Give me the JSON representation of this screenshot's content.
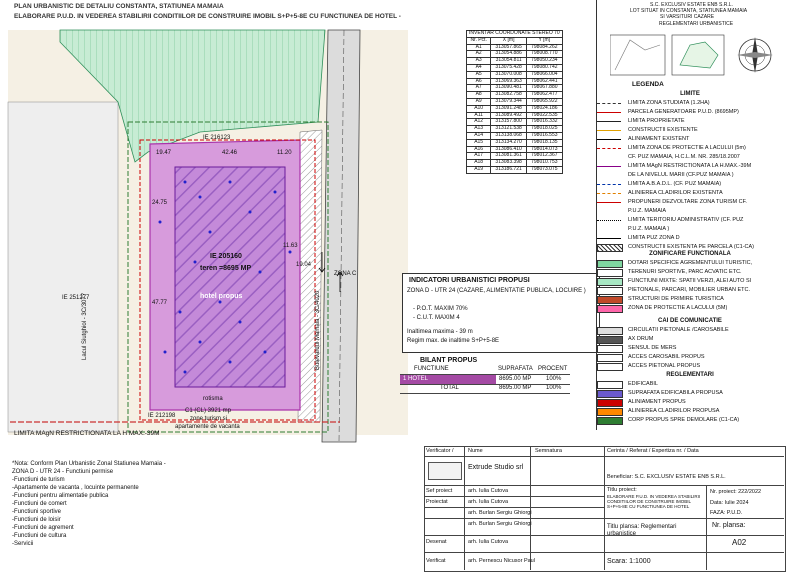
{
  "header": {
    "line1": "PLAN URBANISTIC  DE DETALIU CONSTANTA, STATIUNEA MAMAIA",
    "line2": "ELABORARE  P.U.D. IN VEDEREA STABILIRII CONDITIILOR DE CONSTRUIRE IMOBIL S+P+5-8E CU FUNCTIUNEA DE HOTEL  -"
  },
  "plan": {
    "ie_top": "IE 216123",
    "ie_main": "IE 205160",
    "teren": "teren  =8695 MP",
    "hotel": "hotel propus",
    "ie_left": "IE 251277",
    "ie_bottom": "IE 212198",
    "c1": "C1 (CL) 3921 mp",
    "zone_line1": "zone turism si",
    "zone_line2": "apartamente de vacanta",
    "rotisma": "rotisma",
    "street_left": "Lacul Siutghiol - 3C/3077",
    "street_right": "Bulevardul Mamaia - 3C/4020",
    "limita_label": "LIMITA MAgN RESTRICTIONATA LA H MAX.-39M",
    "zona_c": "ZONA C",
    "dims": [
      "19.47",
      "42.46",
      "11.20",
      "19.04",
      "24.75",
      "11.63",
      "47.77"
    ]
  },
  "coord_table": {
    "title": "INVENTAR COORDONATE STEREO 70",
    "headers": [
      "Nr. Pct.",
      "X [m]",
      "Y [m]"
    ],
    "rows": [
      [
        "A1",
        "313057.865",
        "798084.262"
      ],
      [
        "A2",
        "313054.886",
        "798008.770"
      ],
      [
        "A3",
        "313054.811",
        "798050.234"
      ],
      [
        "A4",
        "313075.428",
        "798080.742"
      ],
      [
        "A5",
        "313070.008",
        "798066.004"
      ],
      [
        "A6",
        "313069.363",
        "798062.441"
      ],
      [
        "A7",
        "313090.481",
        "798067.880"
      ],
      [
        "A8",
        "313082.758",
        "798062.477"
      ],
      [
        "A9",
        "313079.344",
        "798065.922"
      ],
      [
        "A10",
        "313091.248",
        "798024.186"
      ],
      [
        "A11",
        "313089.492",
        "798022.535"
      ],
      [
        "A12",
        "313157.800",
        "798016.332"
      ],
      [
        "A13",
        "313121.538",
        "798018.025"
      ],
      [
        "A14",
        "313138.068",
        "798016.553"
      ],
      [
        "A15",
        "313134.270",
        "798018.135"
      ],
      [
        "A16",
        "313086.410",
        "798014.073"
      ],
      [
        "A17",
        "313081.361",
        "798012.367"
      ],
      [
        "A18",
        "313083.398",
        "798010.753"
      ],
      [
        "A19",
        "313186.721",
        "798073.075"
      ]
    ]
  },
  "indicators": {
    "title": "INDICATORI URBANISTICI  PROPUSI",
    "zone": "ZONA D - UTR 24 (CAZARE, ALIMENTATIE PUBLICA, LOCUIRE )",
    "pot": "- P.O.T. MAXIM 70%",
    "cut": "- C.U.T. MAXIM 4",
    "height": "Inaltimea maxima  - 39 m",
    "regim": "Regim max. de inaltime S+P+5-8E",
    "bilant_title": "BILANT PROPUS",
    "bilant_headers": [
      "FUNCTIUNE",
      "SUPRAFATA",
      "PROCENT"
    ],
    "bilant_rows": [
      [
        "1  HOTEL",
        "8695.00 MP",
        "100%"
      ],
      [
        "TOTAL",
        "8695.00 MP",
        "100%"
      ]
    ]
  },
  "legend": {
    "owner_line1": "S.C. EXCLUSIV ESTATE ENB S.R.L.",
    "owner_line2": "LOT SITUAT IN CONSTANTA, STATIUNEA MAMAIA",
    "owner_line3": "SI VARSITURI CAZARE",
    "reglementari": "REGLEMENTARI URBANISTICE",
    "legenda": "LEGENDA",
    "sections": {
      "limite": "LIMITE",
      "zonificare": "ZONIFICARE FUNCTIONALA",
      "cai": "CAI DE COMUNICATIE",
      "regl": "REGLEMENTARI"
    },
    "limite_items": [
      {
        "label": "LIMITA ZONA STUDIATA (1.2HA)",
        "color": "#333333",
        "style": "dash"
      },
      {
        "label": "PARCELA GENERATOARE  P.U.D. (8695MP)",
        "color": "#cc0000",
        "style": "solid"
      },
      {
        "label": "LIMITA PROPRIETATE",
        "color": "#222222",
        "style": "solid"
      },
      {
        "label": "CONSTRUCTII EXISTENTE",
        "color": "#e0a000",
        "style": "solid"
      },
      {
        "label": "ALINIAMENT   EXISTENT",
        "color": "#000000",
        "style": "solid"
      },
      {
        "label": "LIMITA ZONA DE PROTECTIE A LACULUI (5m)",
        "color": "#cc0000",
        "style": "dash"
      },
      {
        "label": "CF. PUZ MAMAIA, H.C.L.M. NR. 285/18.2007",
        "color": "#ffffff",
        "style": "none"
      },
      {
        "label": "LIMITA MAgN RESTRICTIONATA LA H.MAX.-39M",
        "color": "#880088",
        "style": "solid"
      },
      {
        "label": "DE LA NIVELUL MARII (CF.PUZ MAMAIA )",
        "color": "#ffffff",
        "style": "none"
      },
      {
        "label": "LIMITA A.B.A.D.L.  (CF. PUZ MAMAIA)",
        "color": "#0033aa",
        "style": "dash"
      },
      {
        "label": "ALINIEREA  CLADIRILOR EXISTENTA",
        "color": "#e08000",
        "style": "dash"
      },
      {
        "label": "PROPUNERI DEZVOLTARE ZONA TURISM CF.",
        "color": "#cc0000",
        "style": "solid"
      },
      {
        "label": "P.U.Z. MAMAIA",
        "color": "#ffffff",
        "style": "none"
      },
      {
        "label": "LIMITA TERITORIU ADMINISTRATIV (CF. PUZ",
        "color": "#000000",
        "style": "dashdot"
      },
      {
        "label": "P.U.Z. MAMAIA )",
        "color": "#ffffff",
        "style": "none"
      },
      {
        "label": "LIMITA PUZ ZONA D",
        "color": "#000000",
        "style": "solid"
      },
      {
        "label": "CONSTRUCTII EXISTENTA PE PARCELA (C1-CA)",
        "color": "#333333",
        "style": "hatch"
      }
    ],
    "zonificare_items": [
      {
        "label": "DOTARI SPECIFICE AGREMENTULUI TURISTIC,",
        "color": "#7fd6a0"
      },
      {
        "label": "TERENURI SPORTIVE, PARC ACVATIC ETC.",
        "color": "#ffffff"
      },
      {
        "label": "FUNCTIUNI MIXTE: SPATII VERZI, ALEI AUTO SI",
        "color": "#a8e8c4"
      },
      {
        "label": "PIETONALE, PARCARI, MOBILIER URBAN ETC.",
        "color": "#ffffff"
      },
      {
        "label": "STRUCTURI DE PRIMIRE TURISTICA",
        "color": "#c24a2a"
      },
      {
        "label": "ZONA DE PROTECTIE A LACULUI (5M)",
        "color": "#ff66aa"
      }
    ],
    "cai_items": [
      {
        "label": "CIRCULATII PIETONALE /CAROSABILE",
        "color": "#dddddd"
      },
      {
        "label": "AX DRUM",
        "color": "#555555"
      },
      {
        "label": "SENSUL DE MERS",
        "color": "#ffffff"
      },
      {
        "label": "ACCES CAROSABIL  PROPUS",
        "color": "#ffffff"
      },
      {
        "label": "ACCES PIETONAL PROPUS",
        "color": "#ffffff"
      }
    ],
    "regl_items": [
      {
        "label": "EDIFICABIL",
        "color": "#ffffff"
      },
      {
        "label": "SUPRAFATA EDIFICABILA PROPUSA",
        "color": "#6a5acd"
      },
      {
        "label": "ALINIAMENT PROPUS",
        "color": "#cc0000"
      },
      {
        "label": "ALINIEREA  CLADIRILOR PROPUSA",
        "color": "#ff8800"
      },
      {
        "label": "CORP PROPUS SPRE DEMOLARE (C1-CA)",
        "color": "#2e7d32"
      }
    ]
  },
  "note": {
    "lines": [
      "*Nota: Conform Plan Urbanistic Zonal Statiunea Mamaia -",
      "ZONA D - UTR 24 - Functiuni permise",
      "-Functiuni de turism",
      "-Apartamente de vacanta , locuinte permanente",
      "-Functiuni pentru alimentatie publica",
      "-Functiuni de comert",
      "-Functiuni sportive",
      "-Functiuni de loisir",
      "-Functiuni de agrement",
      "-Functiuni de cultura",
      "-Servicii"
    ]
  },
  "title_block": {
    "verificator": "Verificator /",
    "nume": "Nume",
    "semnatura": "Semnatura",
    "cerinta": "Cerinta / Referat / Expertiza nr. / Data",
    "company": "Extrude Studio srl",
    "beneficiar": "Beneficiar: S.C. EXCLUSIV ESTATE ENB  S.R.L.",
    "sef_proiect_role": "Sef proiect",
    "proiectat_role": "Proiectat",
    "desenat_role": "Desenat",
    "verificat_role": "Verificat",
    "name_1": "arh. Iulia Cutova",
    "name_2": "arh. Iulia Cutova",
    "name_3": "arh. Burlan Sergiu Ghiorgi",
    "name_4": "arh. Burlan Sergiu Ghiorgi",
    "name_5": "arh. Iulia Cutova",
    "name_6": "arh. Pernescu Nicusor Paul",
    "titlu_proiect": "Titlu proiect:",
    "proiect_desc": "ELABORARE P.U.D. IN VEDEREA STABILIRII CONDITIILOR DE CONSTRUIRE IMOBIL S+P+5-8E CU FUNCTIUNEA DE HOTEL",
    "nr_proiect": "Nr. proiect: 222/2022",
    "data": "Data: Iulie 2024",
    "faza": "FAZA: P.U.D.",
    "titlu_plansa": "Titlu plansa: Reglementari urbanistice",
    "nr_plansa_label": "Nr. plansa:",
    "nr_plansa": "A02",
    "scara": "Scara: 1:1000"
  }
}
